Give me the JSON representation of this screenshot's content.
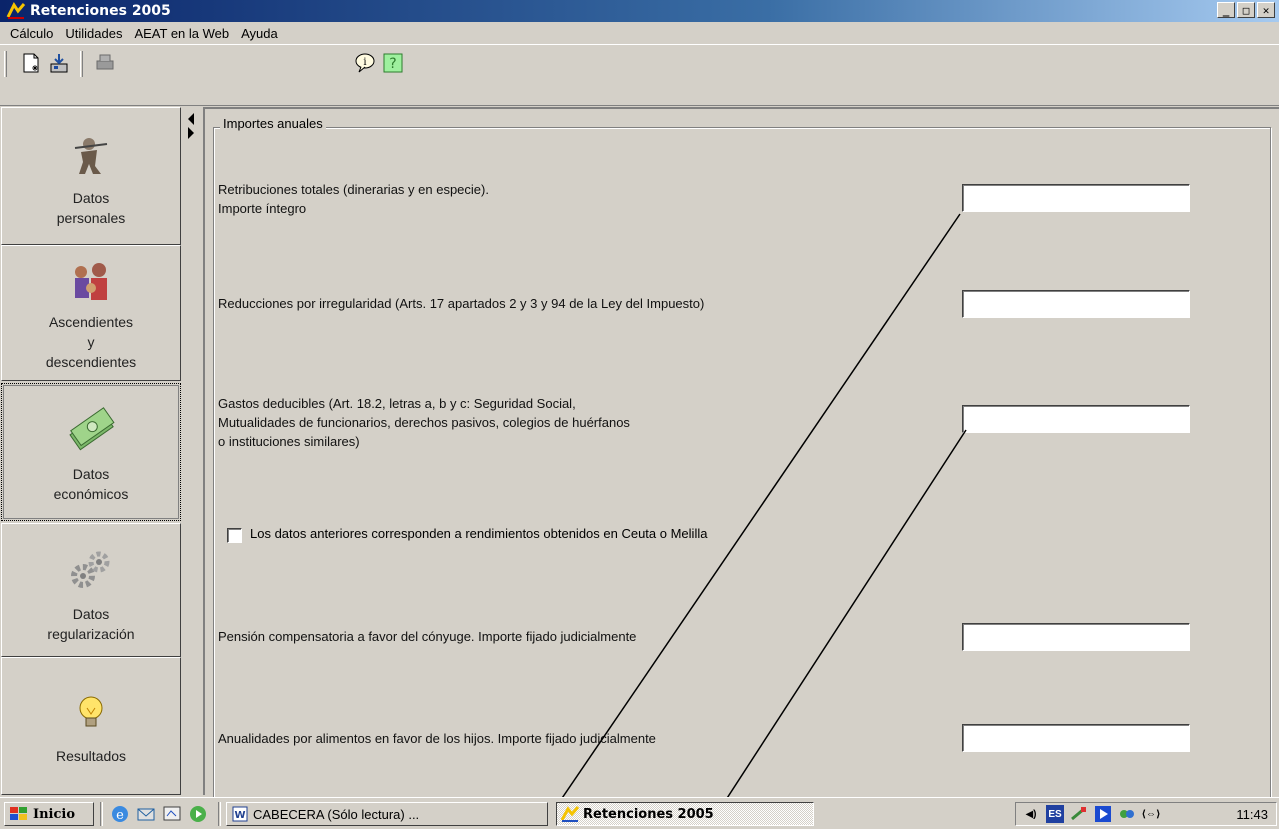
{
  "window": {
    "title": "Retenciones 2005"
  },
  "menu": [
    "Cálculo",
    "Utilidades",
    "AEAT en la Web",
    "Ayuda"
  ],
  "nav": [
    {
      "label1": "Datos",
      "label2": "personales",
      "icon": "worker-icon"
    },
    {
      "label1": "Ascendientes",
      "label2": "y",
      "label3": "descendientes",
      "icon": "family-icon"
    },
    {
      "label1": "Datos",
      "label2": "económicos",
      "icon": "money-icon",
      "active": true
    },
    {
      "label1": "Datos",
      "label2": "regularización",
      "icon": "gears-icon"
    },
    {
      "label1": "Resultados",
      "icon": "lightbulb-icon"
    }
  ],
  "group": {
    "legend": "Importes anuales"
  },
  "fields": [
    {
      "line1": "Retribuciones totales (dinerarias y en especie).",
      "line2": "Importe íntegro",
      "value": ""
    },
    {
      "line1": "Reducciones por irregularidad (Arts. 17 apartados 2 y 3 y 94 de la Ley del Impuesto)",
      "value": ""
    },
    {
      "line1": "Gastos deducibles (Art. 18.2, letras a, b y c: Seguridad Social,",
      "line2": "Mutualidades de funcionarios, derechos pasivos, colegios de huérfanos",
      "line3": "o instituciones similares)",
      "value": ""
    },
    {
      "line1": "Pensión compensatoria a favor del cónyuge. Importe fijado judicialmente",
      "value": ""
    },
    {
      "line1": "Anualidades por alimentos en favor de los hijos. Importe fijado judicialmente",
      "value": ""
    }
  ],
  "checkbox": {
    "label": "Los datos anteriores corresponden a rendimientos obtenidos en Ceuta o Melilla",
    "checked": false
  },
  "taskbar": {
    "start": "Inicio",
    "tasks": [
      "CABECERA (Sólo lectura) ...",
      "Retenciones 2005"
    ],
    "tray_lang": "ES",
    "clock": "11:43"
  }
}
